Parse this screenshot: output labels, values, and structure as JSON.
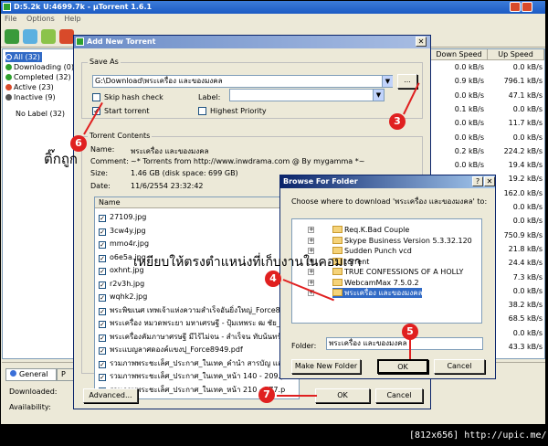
{
  "app": {
    "title": "D:5.2k U:4699.7k - µTorrent 1.6.1",
    "menu": [
      "File",
      "Options",
      "Help"
    ]
  },
  "sidebar": {
    "items": [
      {
        "label": "All (32)",
        "color": "#3a6fd8"
      },
      {
        "label": "Downloading (0)",
        "color": "#2ea02e"
      },
      {
        "label": "Completed (32)",
        "color": "#2ea02e"
      },
      {
        "label": "Active (23)",
        "color": "#d84a2a"
      },
      {
        "label": "Inactive (9)",
        "color": "#555555"
      }
    ],
    "no_label": "No Label (32)"
  },
  "list": {
    "headers": {
      "down": "Down Speed",
      "up": "Up Speed"
    },
    "rows": [
      {
        "down": "0.0 kB/s",
        "up": "0.0 kB/s"
      },
      {
        "down": "0.9 kB/s",
        "up": "796.1 kB/s"
      },
      {
        "down": "0.0 kB/s",
        "up": "47.1 kB/s"
      },
      {
        "down": "0.1 kB/s",
        "up": "0.0 kB/s"
      },
      {
        "down": "0.0 kB/s",
        "up": "11.7 kB/s"
      },
      {
        "down": "0.0 kB/s",
        "up": "0.0 kB/s"
      },
      {
        "down": "0.2 kB/s",
        "up": "224.2 kB/s"
      },
      {
        "down": "0.0 kB/s",
        "up": "19.4 kB/s"
      },
      {
        "down": "",
        "up": "19.2 kB/s"
      },
      {
        "down": "",
        "up": "162.0 kB/s"
      },
      {
        "down": "",
        "up": "0.0 kB/s"
      },
      {
        "down": "",
        "up": "0.0 kB/s"
      },
      {
        "down": "",
        "up": "750.9 kB/s"
      },
      {
        "down": "",
        "up": "21.8 kB/s"
      },
      {
        "down": "",
        "up": "24.4 kB/s"
      },
      {
        "down": "",
        "up": "7.3 kB/s"
      },
      {
        "down": "",
        "up": "0.0 kB/s"
      },
      {
        "down": "",
        "up": "38.2 kB/s"
      },
      {
        "down": "",
        "up": "68.5 kB/s"
      },
      {
        "down": "",
        "up": "0.0 kB/s"
      },
      {
        "down": "",
        "up": "43.3 kB/s"
      }
    ]
  },
  "bottom": {
    "tab_general": "General",
    "tab_peers": "P",
    "downloaded_label": "Downloaded:",
    "availability_label": "Availability:"
  },
  "add_torrent": {
    "title": "Add New Torrent",
    "save_as_label": "Save As",
    "save_path": "G:\\Download\\พระเครื่อง และของมงคล",
    "browse_label": "...",
    "skip_hash_label": "Skip hash check",
    "start_torrent_label": "Start torrent",
    "label_label": "Label:",
    "label_value": "",
    "highest_priority_label": "Highest Priority",
    "contents_label": "Torrent Contents",
    "name_key": "Name:",
    "name_value": "พระเครื่อง และของมงคล",
    "comment_key": "Comment:",
    "comment_value": "~* Torrents from http://www.inwdrama.com @ By mygamma *~",
    "size_key": "Size:",
    "size_value": "1.46 GB (disk space: 699 GB)",
    "date_key": "Date:",
    "date_value": "11/6/2554 23:32:42",
    "files_header": "Name",
    "files": [
      "27109.jpg",
      "3cw4y.jpg",
      "mmo4r.jpg",
      "o6e5a.jpg",
      "oxhnt.jpg",
      "r2v3h.jpg",
      "wqhk2.jpg",
      "พระพิฆเนศ เทพเจ้าแห่งความสำเร็จอันยิ่งใหญ่_Force8949",
      "พระเครื่อง หมวดพระยา มหาเศรษฐี - ปุ้มเทพระ ฒ ชัย_Force8949",
      "พระเครื่องคัมภาษาศรษฐี มีไร้ไม่จน - สำเร็จน ทับน้นทร์_Force8949",
      "พระแบญลาศดองค์แขงปุ_Force8949.pdf",
      "รวมภาพพระชะเล็ศ_ประกาศ_ในเทค_คำนำ สารบัญ และ",
      "รวมภาพพระชะเล็ศ_ประกาศ_ในเทค_หน้า 140 - 209.p",
      "รวมภาพพระชะเล็ศ_ประกาศ_ในเทค_หน้า 210 - 277.p"
    ],
    "advanced_label": "Advanced...",
    "ok_label": "OK",
    "cancel_label": "Cancel"
  },
  "browse_folder": {
    "title": "Browse For Folder",
    "prompt": "Choose where to download 'พระเครื่อง และของมงคล' to:",
    "tree": [
      "Req.K.Bad Couple",
      "Skype Business Version 5.3.32.120",
      "Sudden Punch vcd",
      "torrent",
      "TRUE CONFESSIONS OF A HOLLY",
      "WebcamMax 7.5.0.2",
      "พระเครื่อง และของมงคล"
    ],
    "folder_label": "Folder:",
    "folder_value": "พระเครื่อง และของมงคล",
    "make_new_label": "Make New Folder",
    "ok_label": "OK",
    "cancel_label": "Cancel"
  },
  "annotations": {
    "n3": "3",
    "n4": "4",
    "n5": "5",
    "n6": "6",
    "n7": "7",
    "tick_text": "ติ๊กถูก",
    "instruction_text": "เหยียบให้ตรงตำแหน่งที่เก็บงานในคอมเรา",
    "marker_color": "#e02020"
  },
  "footer": "[812x656] http://upic.me/"
}
